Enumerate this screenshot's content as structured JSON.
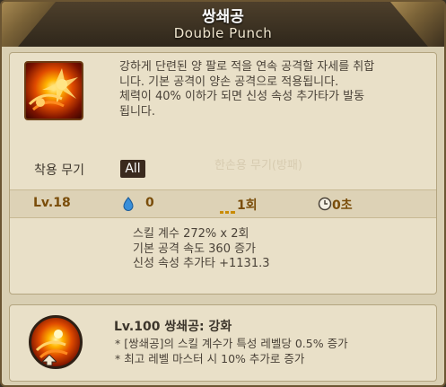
{
  "header": {
    "title_ko": "쌍쇄공",
    "title_en": "Double Punch"
  },
  "skill": {
    "description": [
      "강하게 단련된 양 팔로 적을 연속 공격할 자세를 취합",
      "니다. 기본 공격이 양손 공격으로 적용됩니다.",
      "체력이 40% 이하가 되면 신성 속성 추가타가 발동",
      "됩니다."
    ],
    "weapon_label": "착용 무기",
    "weapon_value": "All",
    "watermark": "한손용 무기(방패)"
  },
  "stats": {
    "level": "Lv.18",
    "mana": "0",
    "uses": "1회",
    "cooldown": "0초"
  },
  "effects": [
    "스킬 계수 272% x 2회",
    "기본 공격 속도 360 증가",
    "신성 속성 추가타 +1131.3"
  ],
  "awaken": {
    "title": "Lv.100  쌍쇄공: 강화",
    "lines": [
      "* [쌍쇄공]의 스킬 계수가 특성 레벨당 0.5% 증가",
      "* 최고 레벨 마스터 시 10% 추가로 증가"
    ]
  },
  "icons": {
    "skill": "double-punch-skill-icon",
    "mana": "water-drop-icon",
    "uses": "dash-icon",
    "cooldown": "clock-icon",
    "awaken": "double-punch-awaken-icon",
    "awaken_badge": "up-arrow-icon"
  },
  "colors": {
    "header_bg": "#3a3226",
    "panel_bg": "#e9e0c8",
    "stat_text": "#7a4d0a",
    "badge_bg": "#3a2a1e"
  }
}
